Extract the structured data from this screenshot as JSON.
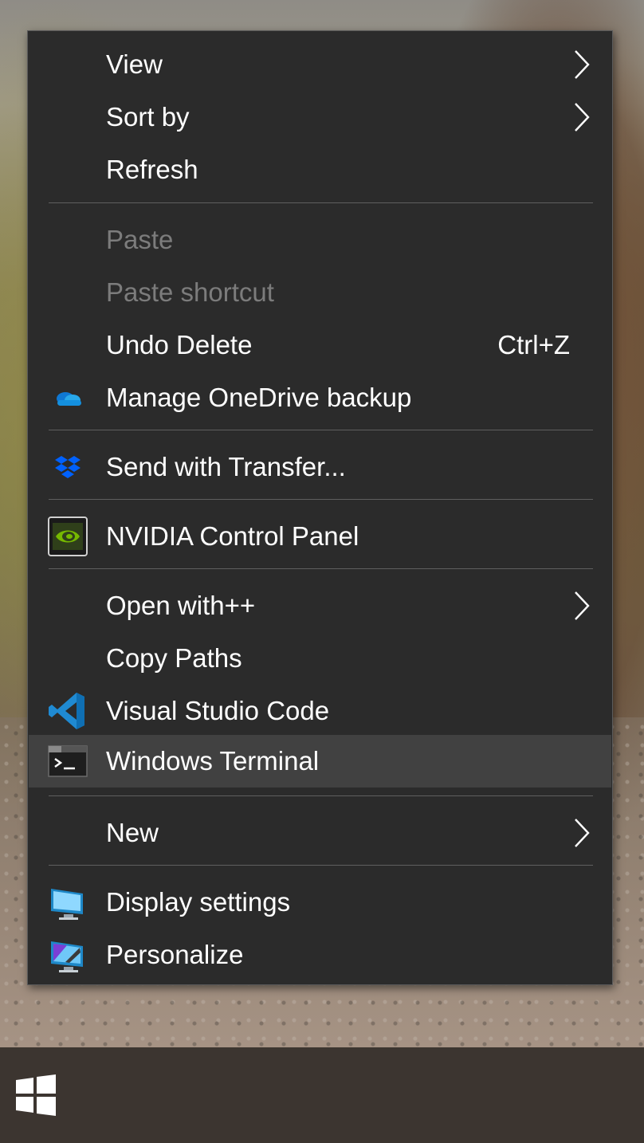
{
  "context_menu": {
    "items": [
      {
        "label": "View",
        "submenu": true
      },
      {
        "label": "Sort by",
        "submenu": true
      },
      {
        "label": "Refresh"
      },
      {
        "label": "Paste",
        "disabled": true
      },
      {
        "label": "Paste shortcut",
        "disabled": true
      },
      {
        "label": "Undo Delete",
        "shortcut": "Ctrl+Z"
      },
      {
        "label": "Manage OneDrive backup",
        "icon": "onedrive-icon"
      },
      {
        "label": "Send with Transfer...",
        "icon": "dropbox-icon"
      },
      {
        "label": "NVIDIA Control Panel",
        "icon": "nvidia-icon"
      },
      {
        "label": "Open with++",
        "submenu": true
      },
      {
        "label": "Copy Paths"
      },
      {
        "label": "Visual Studio Code",
        "icon": "vscode-icon"
      },
      {
        "label": "Windows Terminal",
        "icon": "terminal-icon",
        "highlighted": true
      },
      {
        "label": "New",
        "submenu": true
      },
      {
        "label": "Display settings",
        "icon": "display-settings-icon"
      },
      {
        "label": "Personalize",
        "icon": "personalize-icon"
      }
    ]
  },
  "taskbar": {
    "start_icon": "windows-logo-icon"
  },
  "colors": {
    "menu_background": "#2b2b2b",
    "menu_highlight": "#414141",
    "text": "#ffffff",
    "text_disabled": "#7c7c7c",
    "separator": "#5f5f5f",
    "taskbar": "#3c3530"
  }
}
